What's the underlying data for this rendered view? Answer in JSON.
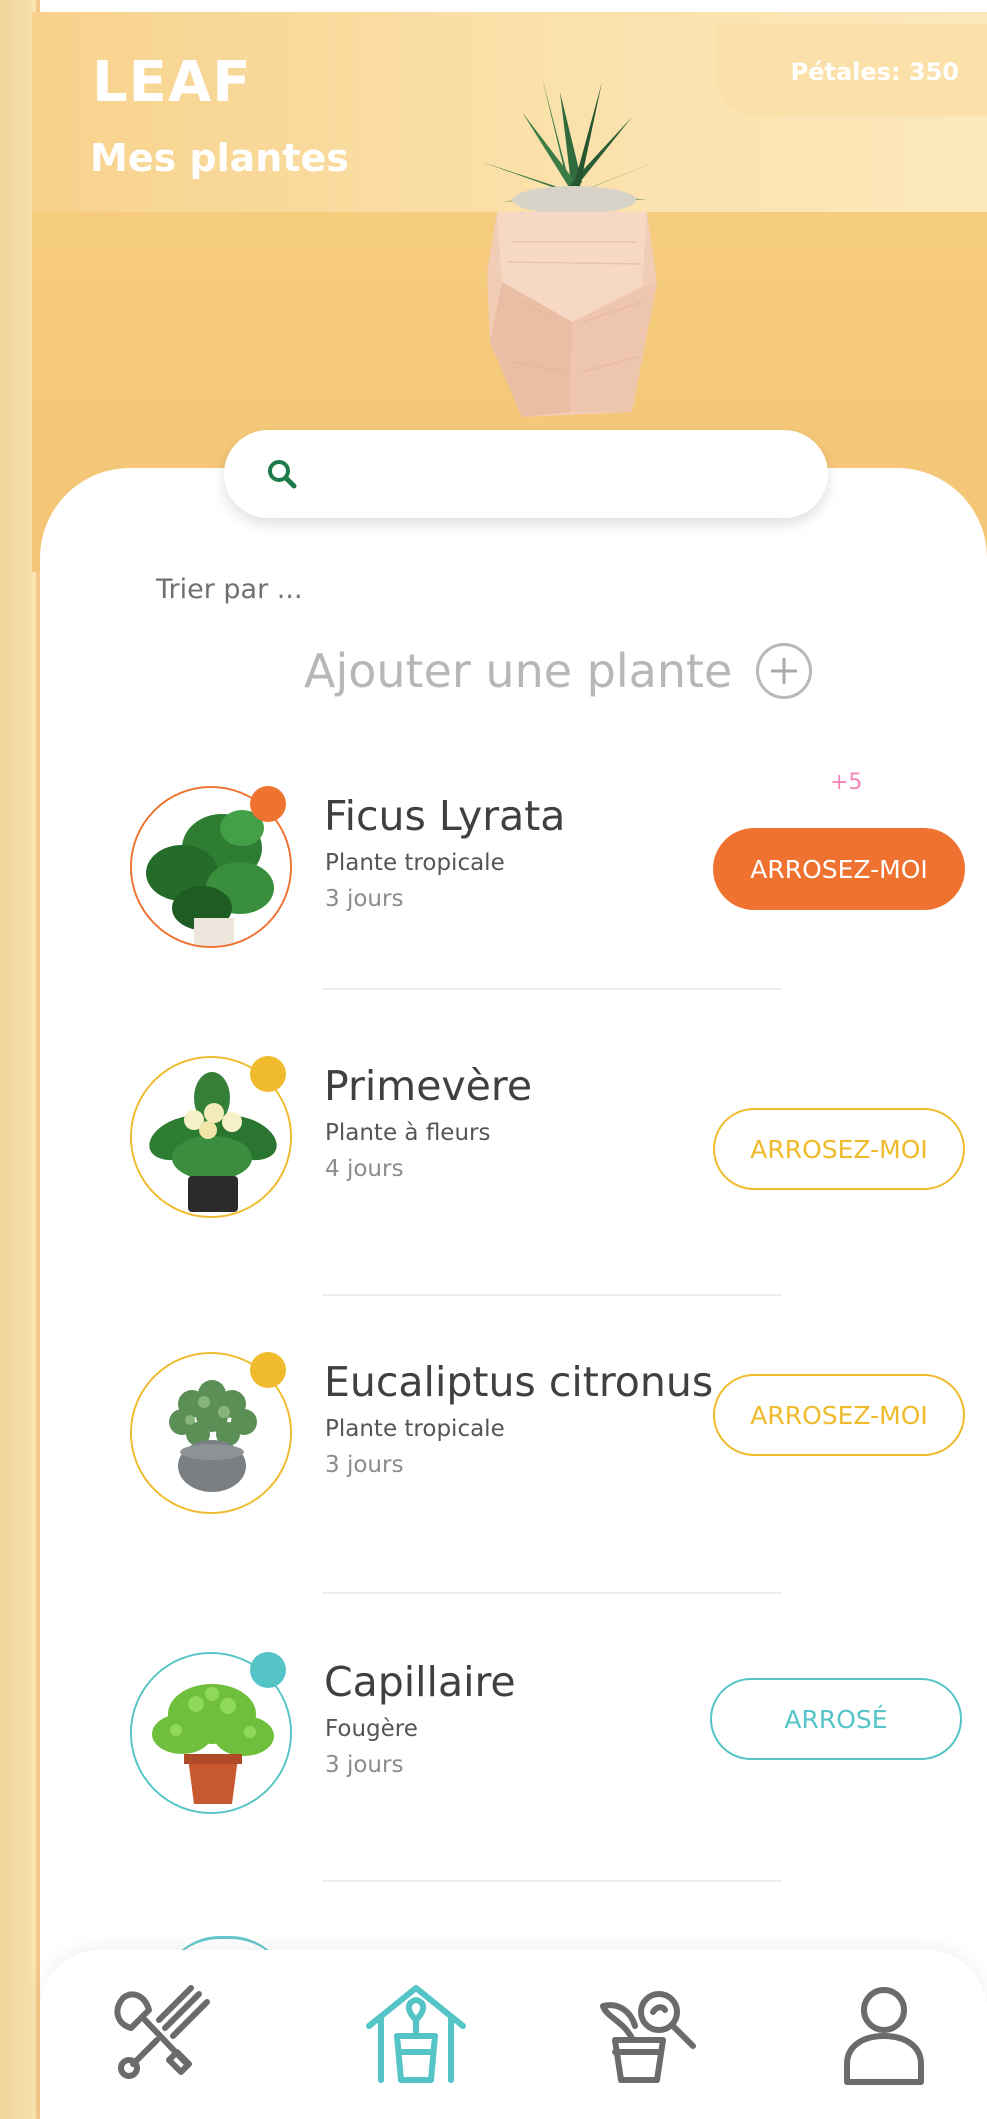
{
  "header": {
    "brand": "LEAF",
    "title": "Mes plantes",
    "petals_label": "Pétales: 350"
  },
  "search": {
    "placeholder": ""
  },
  "sort": {
    "label": "Trier par ..."
  },
  "add_plant": {
    "label": "Ajouter une plante"
  },
  "plants": [
    {
      "name": "Ficus Lyrata",
      "type": "Plante tropicale",
      "days": "3 jours",
      "action": "ARROSEZ-MOI",
      "bonus": "+5",
      "status_color": "#ef7230",
      "state": "urgent"
    },
    {
      "name": "Primevère",
      "type": "Plante à fleurs",
      "days": "4 jours",
      "action": "ARROSEZ-MOI",
      "status_color": "#efbb2c",
      "state": "pending"
    },
    {
      "name": "Eucaliptus citronus",
      "type": "Plante tropicale",
      "days": "3 jours",
      "action": "ARROSEZ-MOI",
      "status_color": "#efbb2c",
      "state": "pending"
    },
    {
      "name": "Capillaire",
      "type": "Fougère",
      "days": "3 jours",
      "action": "ARROSÉ",
      "status_color": "#54c4c7",
      "state": "watered"
    }
  ],
  "nav": {
    "items": [
      {
        "icon": "garden-tools-icon",
        "active": false
      },
      {
        "icon": "plant-house-icon",
        "active": true
      },
      {
        "icon": "plant-search-icon",
        "active": false
      },
      {
        "icon": "profile-icon",
        "active": false
      }
    ]
  },
  "colors": {
    "hero_background": "#f6c879",
    "urgent": "#ef7230",
    "pending": "#efbb2c",
    "watered": "#54c4c7",
    "nav_active": "#54c4c7",
    "nav_inactive": "#6b6b6b"
  }
}
